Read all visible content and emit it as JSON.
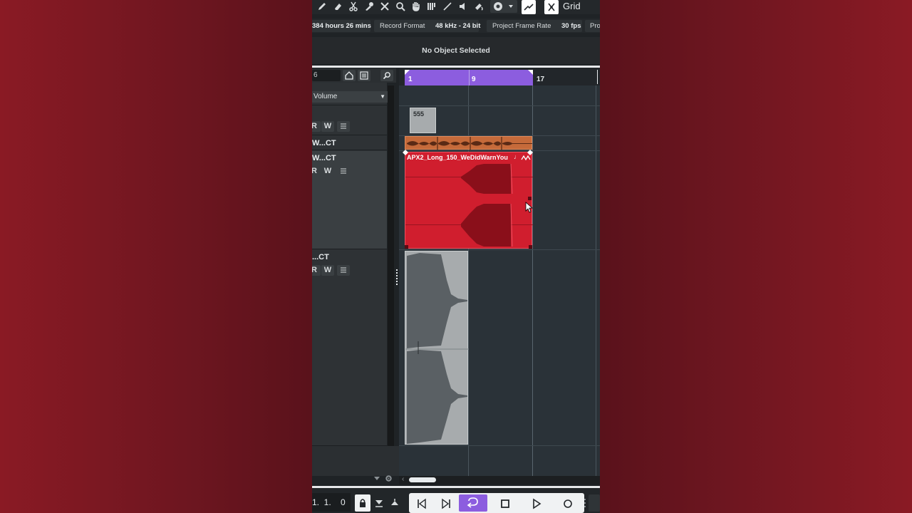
{
  "toolbar": {
    "tools": [
      "pencil-icon",
      "eraser-icon",
      "scissors-icon",
      "glue-icon",
      "mute-x-icon",
      "zoom-icon",
      "hand-icon",
      "comp-icon",
      "line-icon",
      "speaker-icon",
      "color-icon"
    ],
    "grid_label": "Grid"
  },
  "statusbar": {
    "record_time": "384 hours 26 mins",
    "record_format_label": "Record Format",
    "record_format_value": "48 kHz - 24 bit",
    "frame_rate_label": "Project Frame Rate",
    "frame_rate_value": "30 fps",
    "project_label": "Pro"
  },
  "infoline": {
    "text": "No Object Selected"
  },
  "track_header": {
    "search_value": "6",
    "automation_param": "Volume"
  },
  "tracks": [
    {
      "name": "",
      "r": "R",
      "w": "W"
    },
    {
      "name": "W...CT"
    },
    {
      "name": "W...CT",
      "r": "R",
      "w": "W"
    },
    {
      "name": "...CT",
      "r": "R",
      "w": "W"
    }
  ],
  "ruler": {
    "marks": [
      "1",
      "9",
      "17"
    ]
  },
  "events": {
    "midi_part_label": "555",
    "audio_event_name": "APX2_Long_150_WeDidWarnYou"
  },
  "transport": {
    "position": "1.  1.    0"
  },
  "colors": {
    "accent": "#8c5ddf",
    "audio_event": "#d01e2e",
    "audio_waveform": "#8a0f1a",
    "orange_part": "#c56a3a",
    "gray_event": "#a7abad",
    "background": "#7a1722"
  }
}
